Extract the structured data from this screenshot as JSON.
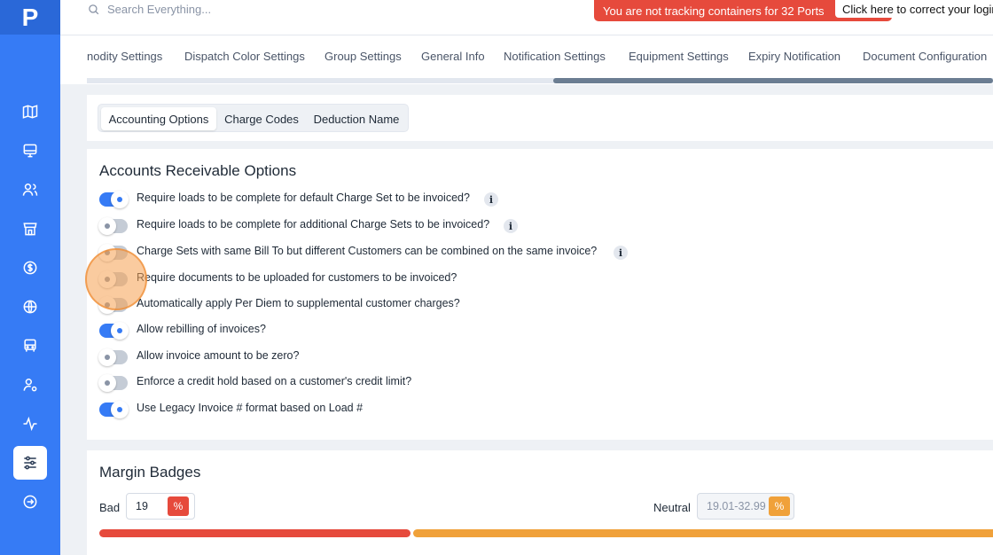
{
  "app": {
    "logo": "P"
  },
  "sidebar": {
    "items": [
      {
        "icon": "map-icon"
      },
      {
        "icon": "monitor-icon"
      },
      {
        "icon": "users-icon"
      },
      {
        "icon": "store-icon"
      },
      {
        "icon": "dollar-icon"
      },
      {
        "icon": "globe-icon"
      },
      {
        "icon": "truck-icon"
      },
      {
        "icon": "user-settings-icon"
      },
      {
        "icon": "activity-icon"
      },
      {
        "icon": "sliders-icon",
        "active": true
      },
      {
        "icon": "logout-icon"
      }
    ]
  },
  "topbar": {
    "search_placeholder": "Search Everything...",
    "alert": "You are not tracking containers for 32 Ports",
    "alert_action": "Click here to correct your login"
  },
  "tabs": [
    "nodity Settings",
    "Dispatch Color Settings",
    "Group Settings",
    "General Info",
    "Notification Settings",
    "Equipment Settings",
    "Expiry Notification",
    "Document Configuration"
  ],
  "subtabs": [
    "Accounting Options",
    "Charge Codes",
    "Deduction Name"
  ],
  "accounts_receivable": {
    "title": "Accounts Receivable Options",
    "options": [
      {
        "label": "Require loads to be complete for default Charge Set to be invoiced?",
        "on": true,
        "info": true
      },
      {
        "label": "Require loads to be complete for additional Charge Sets to be invoiced?",
        "on": false,
        "info": true
      },
      {
        "label": "Charge Sets with same Bill To but different Customers can be combined on the same invoice?",
        "on": false,
        "info": true
      },
      {
        "label": "Require documents to be uploaded for customers to be invoiced?",
        "on": false,
        "info": false
      },
      {
        "label": "Automatically apply Per Diem to supplemental customer charges?",
        "on": false,
        "info": false
      },
      {
        "label": "Allow rebilling of invoices?",
        "on": true,
        "info": false
      },
      {
        "label": "Allow invoice amount to be zero?",
        "on": false,
        "info": false
      },
      {
        "label": "Enforce a credit hold based on a customer's credit limit?",
        "on": false,
        "info": false
      },
      {
        "label": "Use Legacy Invoice # format based on Load #",
        "on": true,
        "info": false
      }
    ]
  },
  "margin_badges": {
    "title": "Margin Badges",
    "bad_label": "Bad",
    "bad_value": "19",
    "neutral_label": "Neutral",
    "neutral_value": "19.01-32.99",
    "percent_symbol": "%",
    "colors": {
      "bad": "#e64a3c",
      "neutral": "#f0a13a"
    }
  }
}
